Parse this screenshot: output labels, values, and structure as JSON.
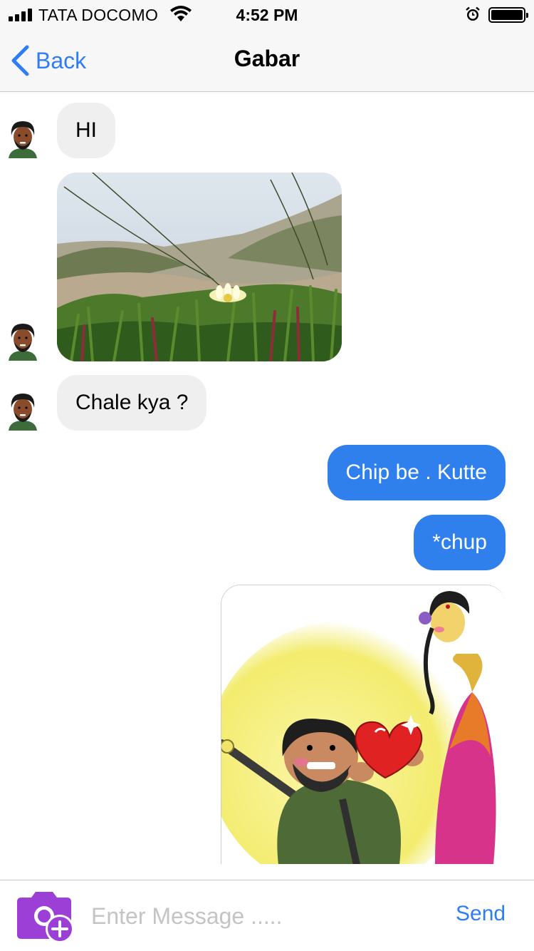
{
  "status_bar": {
    "carrier": "TATA DOCOMO",
    "time": "4:52 PM",
    "icons": [
      "signal-icon",
      "wifi-icon",
      "alarm-icon",
      "battery-icon"
    ]
  },
  "nav": {
    "back_label": "Back",
    "title": "Gabar"
  },
  "messages": [
    {
      "direction": "incoming",
      "type": "text",
      "text": "HI"
    },
    {
      "direction": "incoming",
      "type": "image",
      "image": "dune-flower-photo"
    },
    {
      "direction": "incoming",
      "type": "text",
      "text": "Chale kya ?"
    },
    {
      "direction": "outgoing",
      "type": "text",
      "text": "Chip be . Kutte"
    },
    {
      "direction": "outgoing",
      "type": "text",
      "text": "*chup"
    },
    {
      "direction": "outgoing",
      "type": "image",
      "image": "cartoon-heart-illustration"
    }
  ],
  "composer": {
    "placeholder": "Enter Message .....",
    "value": "",
    "send_label": "Send",
    "camera_icon": "camera-add-icon"
  },
  "colors": {
    "accent": "#2f7df6",
    "outgoing_bubble": "#2f80ed",
    "incoming_bubble": "#efefef",
    "camera_icon": "#9b3fd6"
  }
}
